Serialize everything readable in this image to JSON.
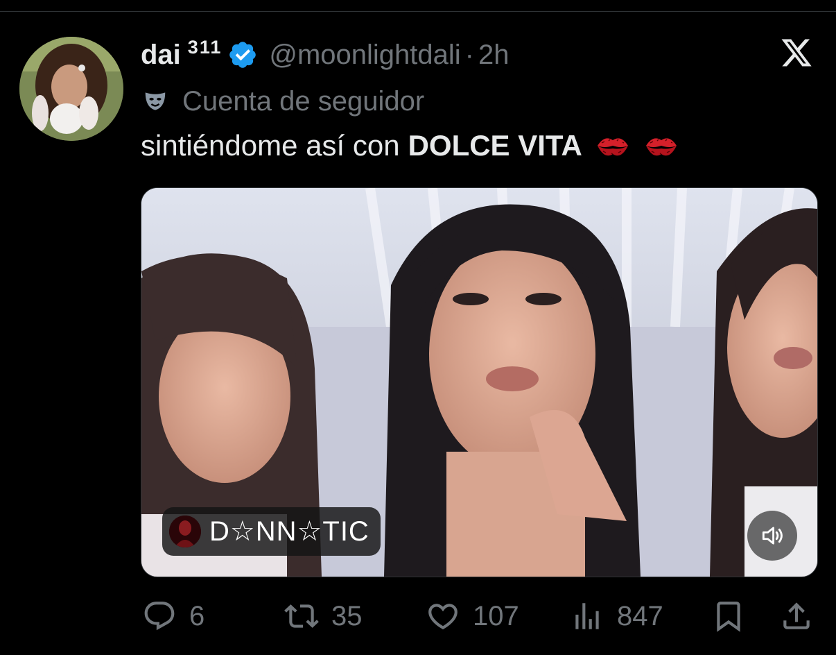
{
  "tweet": {
    "display_name": "dai",
    "name_superscript": "311",
    "handle": "@moonlightdali",
    "separator": "·",
    "time": "2h",
    "account_label": "Cuenta de seguidor",
    "text_prefix": "sintiéndome así con",
    "text_bold": "DOLCE VITA",
    "emoji": [
      "kiss-mark-icon",
      "kiss-mark-icon"
    ]
  },
  "media": {
    "sound_label": "D☆NN☆TIC",
    "volume_icon": "speaker-icon"
  },
  "actions": {
    "replies": "6",
    "reposts": "35",
    "likes": "107",
    "views": "847"
  },
  "colors": {
    "background": "#000000",
    "text": "#e7e9ea",
    "muted": "#71767b",
    "verified": "#1d9bf0"
  }
}
